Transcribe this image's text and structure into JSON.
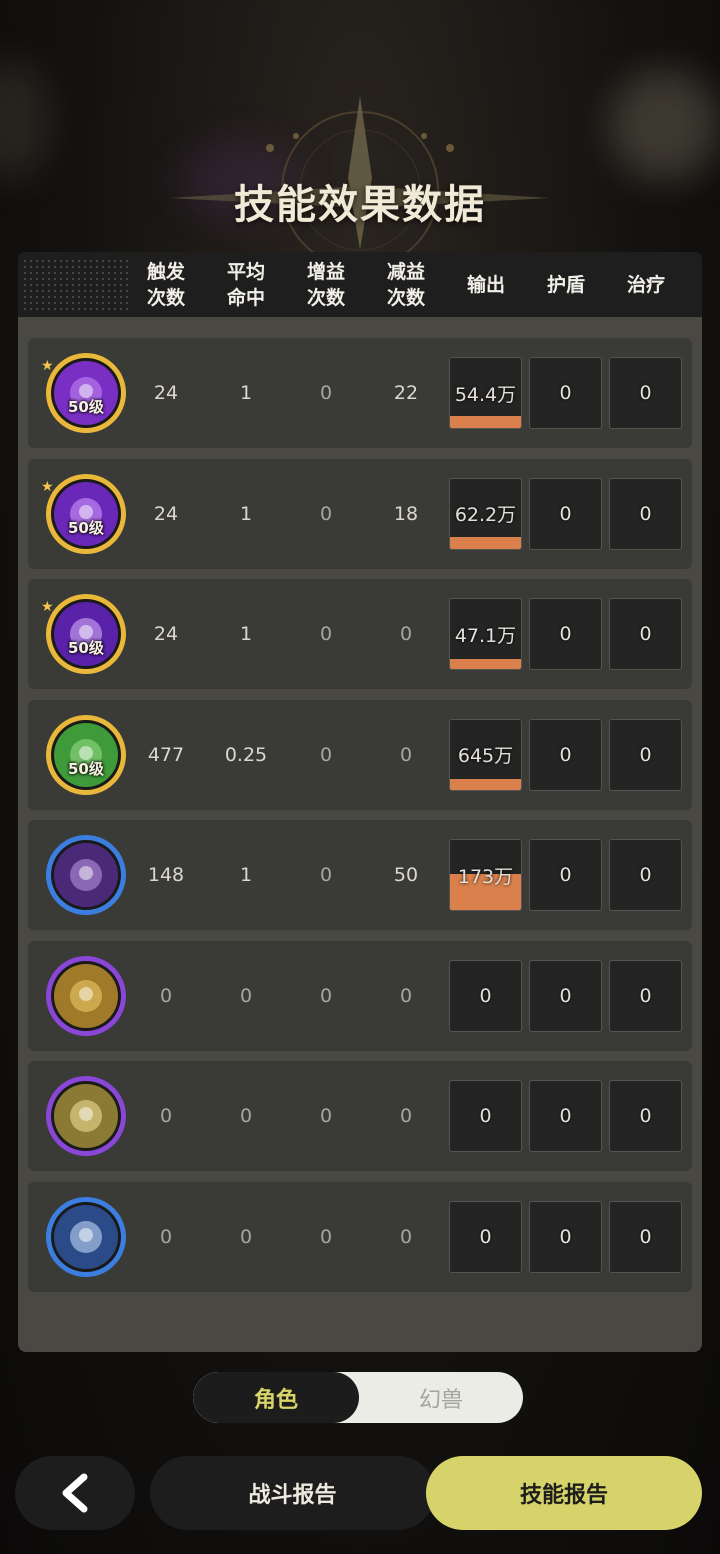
{
  "title": "技能效果数据",
  "columns": [
    {
      "label": "触发\n次数"
    },
    {
      "label": "平均\n命中"
    },
    {
      "label": "增益\n次数"
    },
    {
      "label": "减益\n次数"
    },
    {
      "label": "输出"
    },
    {
      "label": "护盾"
    },
    {
      "label": "治疗"
    }
  ],
  "rows": [
    {
      "icon": "purple-eye-skill-icon",
      "star": "★",
      "level": "50级",
      "trigger": "24",
      "avg_hit": "1",
      "buff": "0",
      "debuff": "22",
      "output": "54.4万",
      "output_fill": 0.17,
      "shield": "0",
      "heal": "0"
    },
    {
      "icon": "purple-claw-skill-icon",
      "star": "★",
      "level": "50级",
      "trigger": "24",
      "avg_hit": "1",
      "buff": "0",
      "debuff": "18",
      "output": "62.2万",
      "output_fill": 0.17,
      "shield": "0",
      "heal": "0"
    },
    {
      "icon": "purple-orb-skill-icon",
      "star": "★",
      "level": "50级",
      "trigger": "24",
      "avg_hit": "1",
      "buff": "0",
      "debuff": "0",
      "output": "47.1万",
      "output_fill": 0.14,
      "shield": "0",
      "heal": "0"
    },
    {
      "icon": "green-scroll-skill-icon",
      "star": "",
      "level": "50级",
      "trigger": "477",
      "avg_hit": "0.25",
      "buff": "0",
      "debuff": "0",
      "output": "645万",
      "output_fill": 0.15,
      "shield": "0",
      "heal": "0"
    },
    {
      "icon": "blue-emblem-skill-icon",
      "star": "",
      "level": "",
      "trigger": "148",
      "avg_hit": "1",
      "buff": "0",
      "debuff": "50",
      "output": "173万",
      "output_fill": 0.5,
      "shield": "0",
      "heal": "0"
    },
    {
      "icon": "gold-beast-skill-icon",
      "star": "",
      "level": "",
      "trigger": "0",
      "avg_hit": "0",
      "buff": "0",
      "debuff": "0",
      "output": "0",
      "output_fill": 0,
      "shield": "0",
      "heal": "0"
    },
    {
      "icon": "gold-flame-skill-icon",
      "star": "",
      "level": "",
      "trigger": "0",
      "avg_hit": "0",
      "buff": "0",
      "debuff": "0",
      "output": "0",
      "output_fill": 0,
      "shield": "0",
      "heal": "0"
    },
    {
      "icon": "blue-star-skill-icon",
      "star": "",
      "level": "",
      "trigger": "0",
      "avg_hit": "0",
      "buff": "0",
      "debuff": "0",
      "output": "0",
      "output_fill": 0,
      "shield": "0",
      "heal": "0"
    }
  ],
  "toggle": {
    "active": "角色",
    "inactive": "幻兽"
  },
  "bottom": {
    "back_icon": "chevron-left-icon",
    "battle_report": "战斗报告",
    "skill_report": "技能报告"
  }
}
